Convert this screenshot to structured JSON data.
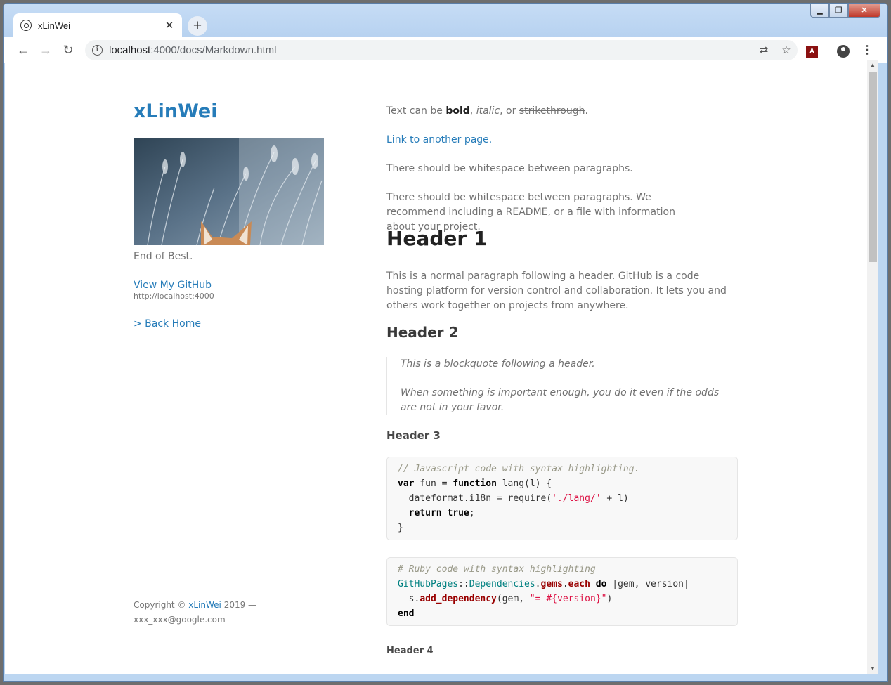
{
  "browser": {
    "tab_title": "xLinWei",
    "new_tab": "+",
    "tab_close": "✕",
    "url_host": "localhost",
    "url_rest": ":4000/docs/Markdown.html",
    "window_controls": {
      "minimize": "▁",
      "maximize": "❐",
      "close": "✕"
    },
    "extension_label": "A"
  },
  "sidebar": {
    "site_title": "xLinWei",
    "caption": "End of Best.",
    "github_link": "View My GitHub",
    "github_url": "http://localhost:4000",
    "back_home": "> Back Home",
    "footer_prefix": "Copyright © ",
    "footer_author": "xLinWei",
    "footer_suffix": " 2019 —",
    "footer_email": "xxx_xxx@google.com"
  },
  "content": {
    "p1_prefix": "Text can be ",
    "p1_bold": "bold",
    "p1_sep1": ", ",
    "p1_italic": "italic",
    "p1_sep2": ", or ",
    "p1_strike": "strikethrough",
    "p1_end": ".",
    "link": "Link to another page.",
    "p2": "There should be whitespace between paragraphs.",
    "p3": "There should be whitespace between paragraphs. We recommend including a README, or a file with information about your project.",
    "h1": "Header 1",
    "p4": "This is a normal paragraph following a header. GitHub is a code hosting platform for version control and collaboration. It lets you and others work together on projects from anywhere.",
    "h2": "Header 2",
    "quote1": "This is a blockquote following a header.",
    "quote2": "When something is important enough, you do it even if the odds are not in your favor.",
    "h3": "Header 3",
    "js_comment": "// Javascript code with syntax highlighting.",
    "js_l2_kw1": "var",
    "js_l2_a": " fun = ",
    "js_l2_kw2": "function",
    "js_l2_b": " lang(l) {",
    "js_l3_a": "  dateformat.i18n = require(",
    "js_l3_str": "'./lang/'",
    "js_l3_b": " + l)",
    "js_l4_a": "  ",
    "js_l4_kw1": "return",
    "js_l4_sp": " ",
    "js_l4_kw2": "true",
    "js_l4_b": ";",
    "js_l5": "}",
    "rb_comment": "# Ruby code with syntax highlighting",
    "rb_l2_cls1": "GitHubPages",
    "rb_l2_op": "::",
    "rb_l2_cls2": "Dependencies",
    "rb_l2_dot1": ".",
    "rb_l2_fn1": "gems",
    "rb_l2_dot2": ".",
    "rb_l2_fn2": "each",
    "rb_l2_sp": " ",
    "rb_l2_kw": "do",
    "rb_l2_b": " |gem, version|",
    "rb_l3_a": "  s.",
    "rb_l3_fn": "add_dependency",
    "rb_l3_b": "(gem, ",
    "rb_l3_str": "\"= #{version}\"",
    "rb_l3_c": ")",
    "rb_l4": "end",
    "h4": "Header 4"
  }
}
